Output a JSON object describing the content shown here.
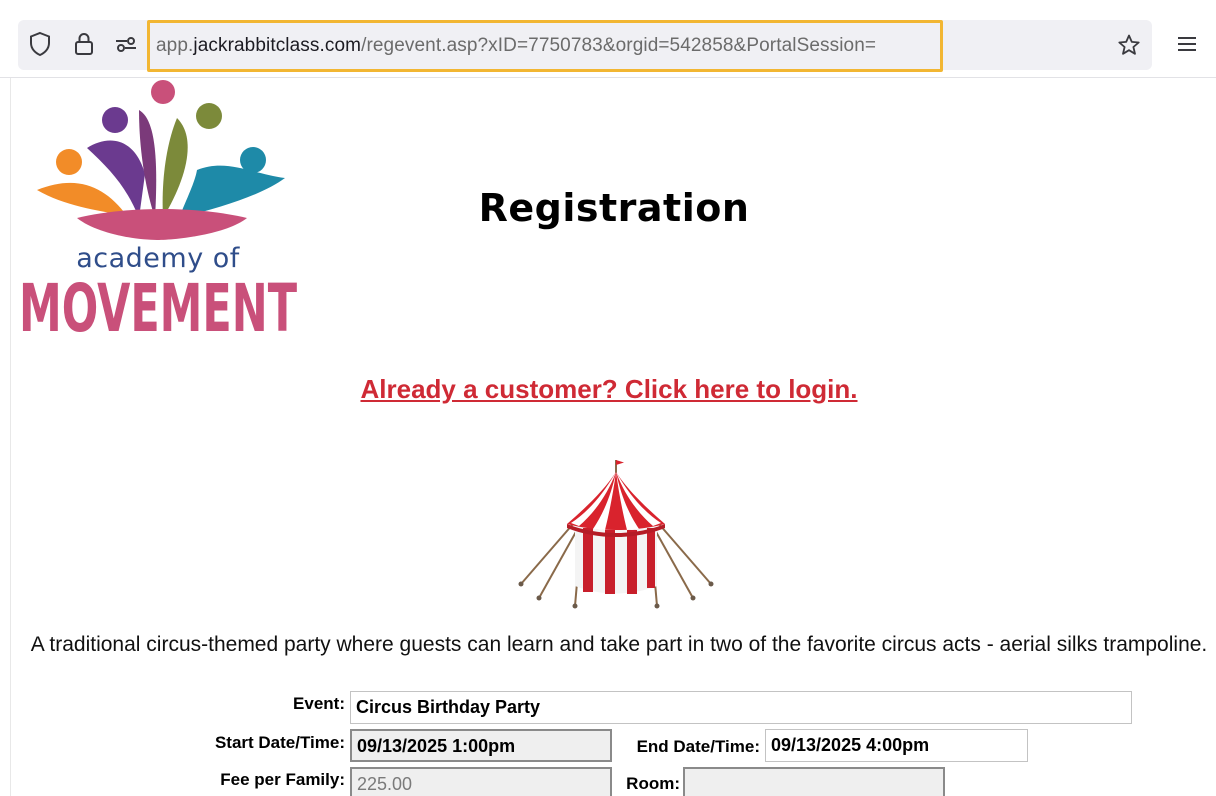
{
  "browser": {
    "url_prefix": "app.",
    "url_domain": "jackrabbitclass.com",
    "url_path": "/regevent.asp?xID=7750783&orgid=542858&PortalSession="
  },
  "logo": {
    "line1": "academy of",
    "line2": "MOVEMENT"
  },
  "page": {
    "title": "Registration",
    "login_link": "Already a customer? Click here to login.",
    "description": "A traditional circus-themed party where guests can learn and take part in two of the favorite circus acts - aerial silks trampoline."
  },
  "form": {
    "event_label": "Event:",
    "event_value": "Circus Birthday Party",
    "start_label": "Start Date/Time:",
    "start_value": "09/13/2025 1:00pm",
    "end_label": "End Date/Time:",
    "end_value": "09/13/2025 4:00pm",
    "fee_label": "Fee per Family:",
    "fee_value": "225.00",
    "room_label": "Room:",
    "room_value": ""
  },
  "colors": {
    "link": "#cf2a35",
    "url_highlight": "#f2b632",
    "logo_text": "#2f4d8a",
    "logo_movement": "#c9507a"
  }
}
